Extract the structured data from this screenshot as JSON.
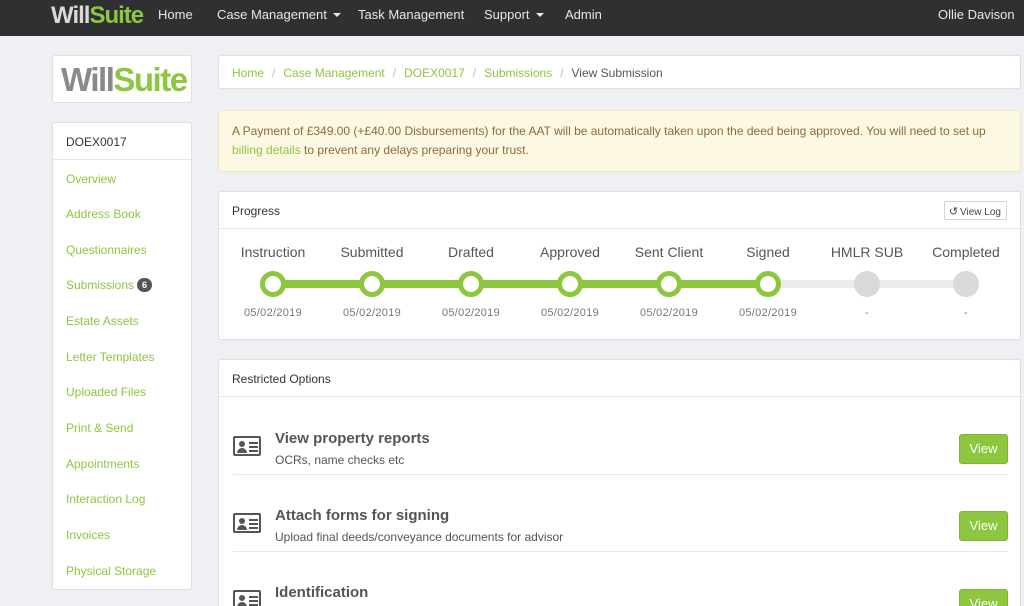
{
  "nav": {
    "logo_w": "Will",
    "logo_s": "Suite",
    "items": [
      "Home",
      "Case Management",
      "Task Management",
      "Support",
      "Admin"
    ],
    "user": "Ollie Davison"
  },
  "sidebar": {
    "logo_w": "Will",
    "logo_s": "Suite",
    "case_ref": "DOEX0017",
    "items": [
      "Overview",
      "Address Book",
      "Questionnaires",
      "Submissions",
      "Estate Assets",
      "Letter Templates",
      "Uploaded Files",
      "Print & Send",
      "Appointments",
      "Interaction Log",
      "Invoices",
      "Physical Storage"
    ],
    "submissions_badge": "6"
  },
  "breadcrumb": {
    "items": [
      "Home",
      "Case Management",
      "DOEX0017",
      "Submissions"
    ],
    "current": "View Submission"
  },
  "alert": {
    "text_before": "A Payment of £349.00 (+£40.00 Disbursements) for the AAT will be automatically taken upon the deed being approved. You will need to set up ",
    "link": "billing details",
    "text_after": " to prevent any delays preparing your trust."
  },
  "progress": {
    "title": "Progress",
    "view_log": "View Log",
    "stages": [
      {
        "label": "Instruction",
        "date": "05/02/2019",
        "done": true
      },
      {
        "label": "Submitted",
        "date": "05/02/2019",
        "done": true
      },
      {
        "label": "Drafted",
        "date": "05/02/2019",
        "done": true
      },
      {
        "label": "Approved",
        "date": "05/02/2019",
        "done": true
      },
      {
        "label": "Sent Client",
        "date": "05/02/2019",
        "done": true
      },
      {
        "label": "Signed",
        "date": "05/02/2019",
        "done": true
      },
      {
        "label": "HMLR SUB",
        "date": "-",
        "done": false
      },
      {
        "label": "Completed",
        "date": "-",
        "done": false
      }
    ]
  },
  "restricted": {
    "title": "Restricted Options",
    "options": [
      {
        "title": "View property reports",
        "subtitle": "OCRs, name checks etc",
        "button": "View"
      },
      {
        "title": "Attach forms for signing",
        "subtitle": "Upload final deeds/conveyance documents for advisor",
        "button": "View"
      },
      {
        "title": "Identification",
        "subtitle": "",
        "button": "View"
      }
    ]
  },
  "colors": {
    "accent": "#8dc63f",
    "navbar": "#2f3032",
    "alert_bg": "#fcf8e3",
    "alert_text": "#8a6d3b",
    "pending": "#d9d9d9"
  },
  "icons": [
    "caret-down-icon",
    "history-icon",
    "id-card-icon"
  ]
}
